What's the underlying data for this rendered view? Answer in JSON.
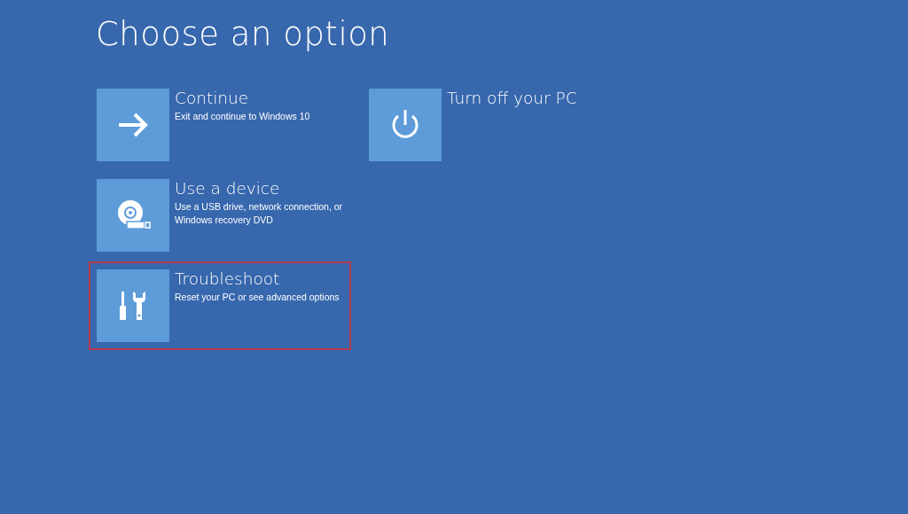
{
  "title": "Choose an option",
  "columns": [
    [
      {
        "kind": "arrow",
        "title": "Continue",
        "description": "Exit and continue to Windows 10",
        "highlighted": false
      },
      {
        "kind": "disc",
        "title": "Use a device",
        "description": "Use a USB drive, network connection, or Windows recovery DVD",
        "highlighted": false
      },
      {
        "kind": "tools",
        "title": "Troubleshoot",
        "description": "Reset your PC or see advanced options",
        "highlighted": true
      }
    ],
    [
      {
        "kind": "power",
        "title": "Turn off your PC",
        "highlighted": false
      }
    ]
  ]
}
